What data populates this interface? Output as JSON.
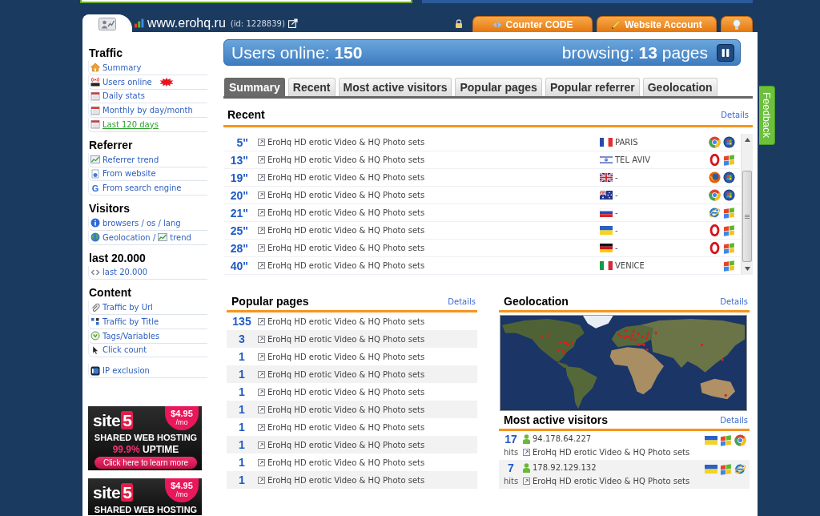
{
  "header": {
    "site": "www.erohq.ru",
    "site_id": "(id: 1228839)",
    "tabs": [
      {
        "kind": "home",
        "selected": true
      },
      {
        "kind": "code",
        "label": "Counter CODE",
        "selected": false
      },
      {
        "kind": "account",
        "label": "Website Account",
        "selected": false
      },
      {
        "kind": "tip",
        "selected": false
      }
    ]
  },
  "sidebar": {
    "sections": [
      {
        "title": "Traffic",
        "items": [
          {
            "kind": "home",
            "label": "Summary",
            "selected": false,
            "new": false
          },
          {
            "kind": "live",
            "label": "Users online",
            "selected": false,
            "new": true
          },
          {
            "kind": "calendar",
            "label": "Daily stats",
            "selected": false,
            "new": false
          },
          {
            "kind": "calendar",
            "label": "Monthly by day/month",
            "selected": false,
            "new": false
          },
          {
            "kind": "calendar",
            "label": "Last 120 days",
            "selected": true,
            "new": false
          }
        ]
      },
      {
        "title": "Referrer",
        "items": [
          {
            "kind": "chart",
            "label": "Referrer trend",
            "selected": false,
            "new": false
          },
          {
            "kind": "page",
            "label": "From website",
            "selected": false,
            "new": false
          },
          {
            "kind": "letter",
            "icon_char": "G",
            "label": "From search engine",
            "selected": false,
            "new": false
          }
        ]
      },
      {
        "title": "Visitors",
        "items": [
          {
            "kind": "info",
            "label": "browsers / os / lang",
            "selected": false,
            "new": false
          },
          {
            "kind": "globe",
            "label": "Geolocation /",
            "suffix": "trend",
            "selected": false,
            "new": false
          }
        ]
      },
      {
        "title": "last 20.000",
        "items": [
          {
            "kind": "code",
            "label": "last 20.000",
            "selected": false,
            "new": false
          }
        ]
      },
      {
        "title": "Content",
        "items": [
          {
            "kind": "clip",
            "label": "Traffic by Url",
            "selected": false,
            "new": false
          },
          {
            "kind": "blocks",
            "label": "Traffic by Title",
            "selected": false,
            "new": false
          },
          {
            "kind": "tag",
            "label": "Tags/Variables",
            "selected": false,
            "new": false
          },
          {
            "kind": "cursor",
            "label": "Click count",
            "selected": false,
            "new": false
          }
        ]
      },
      {
        "items": [
          {
            "kind": "ip",
            "label": "IP exclusion",
            "selected": false,
            "new": false
          }
        ]
      }
    ]
  },
  "ads": [
    {
      "brand": "site",
      "brand_number": "5",
      "price": "$4.95",
      "price_unit": "/mo",
      "headline": "SHARED WEB HOSTING",
      "uptime_value": "99.9%",
      "uptime_label": "UPTIME",
      "button": "Click here to learn more"
    },
    {
      "brand": "site",
      "brand_number": "5",
      "price": "$4.95",
      "price_unit": "/mo",
      "headline": "SHARED WEB HOSTING"
    }
  ],
  "online_bar": {
    "label": "Users online:",
    "count": "150",
    "browsing_label": "browsing:",
    "pages_count": "13",
    "pages_label": "pages",
    "paused": false
  },
  "tabs": [
    {
      "label": "Summary",
      "selected": true
    },
    {
      "label": "Recent",
      "selected": false
    },
    {
      "label": "Most active visitors",
      "selected": false
    },
    {
      "label": "Popular pages",
      "selected": false
    },
    {
      "label": "Popular referrer",
      "selected": false
    },
    {
      "label": "Geolocation",
      "selected": false
    }
  ],
  "recent": {
    "title": "Recent",
    "details": "Details",
    "rows": [
      {
        "time": "5\"",
        "page": "EroHq HD erotic Video & HQ Photo sets",
        "flag": {
          "kind": "fr"
        },
        "city": "PARIS",
        "icons": [
          {
            "kind": "chrome"
          },
          {
            "kind": "vista"
          }
        ]
      },
      {
        "time": "13\"",
        "page": "EroHq HD erotic Video & HQ Photo sets",
        "flag": {
          "kind": "il"
        },
        "city": "TEL AVIV",
        "icons": [
          {
            "kind": "opera"
          },
          {
            "kind": "xp"
          }
        ]
      },
      {
        "time": "19\"",
        "page": "EroHq HD erotic Video & HQ Photo sets",
        "flag": {
          "kind": "gb"
        },
        "city": "-",
        "icons": [
          {
            "kind": "firefox"
          },
          {
            "kind": "vista"
          }
        ]
      },
      {
        "time": "20\"",
        "page": "EroHq HD erotic Video & HQ Photo sets",
        "flag": {
          "kind": "au"
        },
        "city": "-",
        "icons": [
          {
            "kind": "chrome"
          },
          {
            "kind": "vista"
          }
        ]
      },
      {
        "time": "21\"",
        "page": "EroHq HD erotic Video & HQ Photo sets",
        "flag": {
          "kind": "ru"
        },
        "city": "-",
        "icons": [
          {
            "kind": "ie"
          },
          {
            "kind": "xp"
          }
        ]
      },
      {
        "time": "25\"",
        "page": "EroHq HD erotic Video & HQ Photo sets",
        "flag": {
          "kind": "ua"
        },
        "city": "-",
        "icons": [
          {
            "kind": "opera"
          },
          {
            "kind": "xp"
          }
        ]
      },
      {
        "time": "28\"",
        "page": "EroHq HD erotic Video & HQ Photo sets",
        "flag": {
          "kind": "de"
        },
        "city": "-",
        "icons": [
          {
            "kind": "opera"
          },
          {
            "kind": "xp"
          }
        ]
      },
      {
        "time": "40\"",
        "page": "EroHq HD erotic Video & HQ Photo sets",
        "flag": {
          "kind": "it"
        },
        "city": "VENICE",
        "icons": [
          {
            "kind": "xp"
          }
        ]
      }
    ]
  },
  "popular_pages": {
    "title": "Popular pages",
    "details": "Details",
    "rows": [
      {
        "count": "135",
        "page": "EroHq HD erotic Video & HQ Photo sets"
      },
      {
        "count": "3",
        "page": "EroHq HD erotic Video & HQ Photo sets"
      },
      {
        "count": "1",
        "page": "EroHq HD erotic Video & HQ Photo sets"
      },
      {
        "count": "1",
        "page": "EroHq HD erotic Video & HQ Photo sets"
      },
      {
        "count": "1",
        "page": "EroHq HD erotic Video & HQ Photo sets"
      },
      {
        "count": "1",
        "page": "EroHq HD erotic Video & HQ Photo sets"
      },
      {
        "count": "1",
        "page": "EroHq HD erotic Video & HQ Photo sets"
      },
      {
        "count": "1",
        "page": "EroHq HD erotic Video & HQ Photo sets"
      },
      {
        "count": "1",
        "page": "EroHq HD erotic Video & HQ Photo sets"
      },
      {
        "count": "1",
        "page": "EroHq HD erotic Video & HQ Photo sets"
      }
    ]
  },
  "geolocation": {
    "title": "Geolocation",
    "details": "Details"
  },
  "most_active_visitors": {
    "title": "Most active visitors",
    "details": "Details",
    "rows": [
      {
        "hits": "17",
        "unit": "hits",
        "ip": "94.178.64.227",
        "page": "EroHq HD erotic Video & HQ Photo sets",
        "flag": {
          "kind": "ua"
        },
        "icons": [
          {
            "kind": "xp"
          },
          {
            "kind": "chrome"
          }
        ]
      },
      {
        "hits": "7",
        "unit": "hits",
        "ip": "178.92.129.132",
        "page": "EroHq HD erotic Video & HQ Photo sets",
        "flag": {
          "kind": "ua"
        },
        "icons": [
          {
            "kind": "xp"
          },
          {
            "kind": "ie"
          }
        ]
      }
    ]
  },
  "feedback": "Feedback"
}
